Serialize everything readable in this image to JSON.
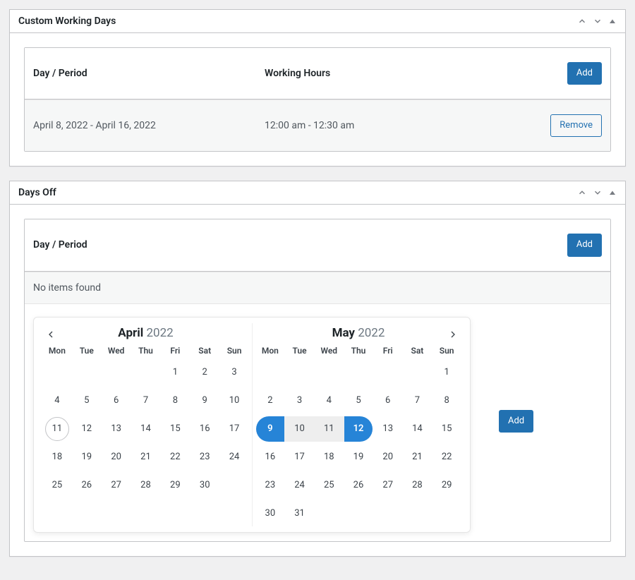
{
  "custom_working_days": {
    "title": "Custom Working Days",
    "head": {
      "day": "Day / Period",
      "hours": "Working Hours",
      "add": "Add"
    },
    "rows": [
      {
        "day": "April 8, 2022 - April 16, 2022",
        "hours": "12:00 am - 12:30 am",
        "remove": "Remove"
      }
    ]
  },
  "days_off": {
    "title": "Days Off",
    "head": {
      "day": "Day / Period",
      "add": "Add"
    },
    "empty": "No items found",
    "calendar": {
      "dow": [
        "Mon",
        "Tue",
        "Wed",
        "Thu",
        "Fri",
        "Sat",
        "Sun"
      ],
      "months": [
        {
          "name": "April",
          "year": "2022",
          "today": 11,
          "grid": [
            [
              null,
              null,
              null,
              null,
              1,
              2,
              3
            ],
            [
              4,
              5,
              6,
              7,
              8,
              9,
              10
            ],
            [
              11,
              12,
              13,
              14,
              15,
              16,
              17
            ],
            [
              18,
              19,
              20,
              21,
              22,
              23,
              24
            ],
            [
              25,
              26,
              27,
              28,
              29,
              30,
              null
            ]
          ]
        },
        {
          "name": "May",
          "year": "2022",
          "selection": {
            "start": 9,
            "end": 12
          },
          "grid": [
            [
              null,
              null,
              null,
              null,
              null,
              null,
              1
            ],
            [
              2,
              3,
              4,
              5,
              6,
              7,
              8
            ],
            [
              9,
              10,
              11,
              12,
              13,
              14,
              15
            ],
            [
              16,
              17,
              18,
              19,
              20,
              21,
              22
            ],
            [
              23,
              24,
              25,
              26,
              27,
              28,
              29
            ],
            [
              30,
              31,
              null,
              null,
              null,
              null,
              null
            ]
          ]
        }
      ],
      "add": "Add"
    }
  }
}
